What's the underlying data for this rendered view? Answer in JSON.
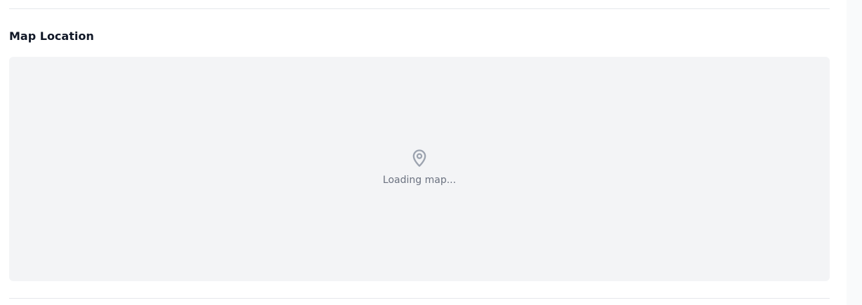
{
  "section": {
    "title": "Map Location"
  },
  "map": {
    "loading_text": "Loading map...",
    "icon": "map-pin-icon"
  },
  "colors": {
    "map_background": "#f3f4f6",
    "muted_text": "#6b7280",
    "icon": "#9ca3af",
    "divider": "#e5e7eb"
  }
}
